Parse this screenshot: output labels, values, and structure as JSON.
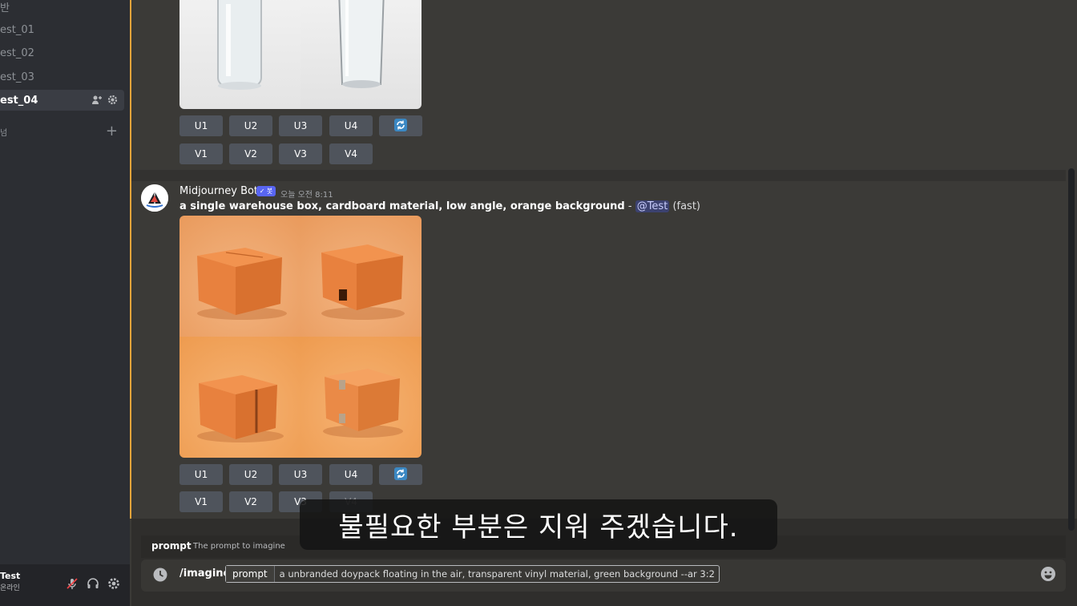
{
  "sidebar": {
    "channels": [
      {
        "label": "반"
      },
      {
        "label": "est_01"
      },
      {
        "label": "est_02"
      },
      {
        "label": "est_03"
      },
      {
        "label": "est_04"
      }
    ],
    "category": {
      "label": "넘"
    },
    "user": {
      "name": "Test",
      "status": "온라인"
    }
  },
  "top_message": {
    "buttons_u": [
      "U1",
      "U2",
      "U3",
      "U4"
    ],
    "buttons_v": [
      "V1",
      "V2",
      "V3",
      "V4"
    ]
  },
  "bottom_message": {
    "author": "Midjourney Bot",
    "badge": "✓ 봇",
    "timestamp": "오늘 오전 8:11",
    "prompt": "a single warehouse box, cardboard material, low angle, orange background",
    "separator": " - ",
    "mention": "@Test",
    "mode": " (fast)",
    "buttons_u": [
      "U1",
      "U2",
      "U3",
      "U4"
    ],
    "buttons_v": [
      "V1",
      "V2",
      "V3",
      "V4"
    ]
  },
  "command_hint": {
    "name": "prompt",
    "description": "The prompt to imagine"
  },
  "command_input": {
    "command": "/imagine",
    "option_label": "prompt",
    "option_value": "a unbranded doypack floating in the air, transparent vinyl material, green background --ar 3:2"
  },
  "subtitle": "불필요한 부분은 지워 주겠습니다.",
  "colors": {
    "accent": "#e6a43a",
    "blurple": "#5865f2",
    "button": "#4f545c"
  }
}
